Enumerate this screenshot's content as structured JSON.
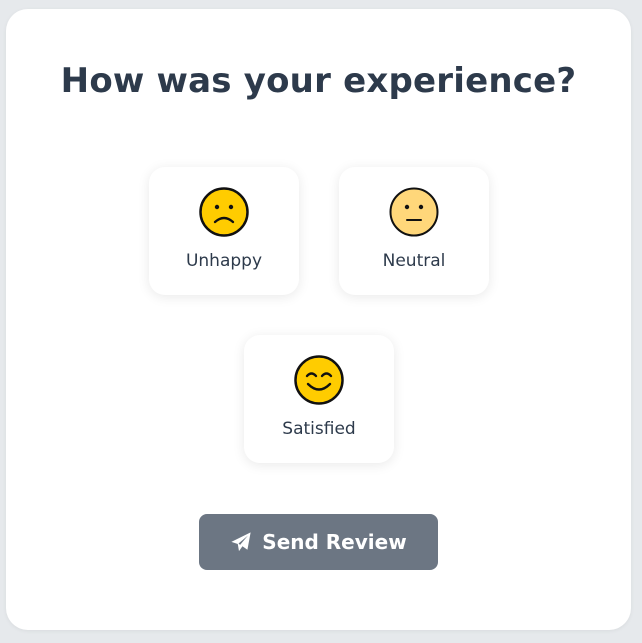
{
  "title": "How was your experience?",
  "options": [
    {
      "label": "Unhappy",
      "icon": "sad-face-icon"
    },
    {
      "label": "Neutral",
      "icon": "neutral-face-icon"
    },
    {
      "label": "Satisfied",
      "icon": "smiling-face-icon"
    }
  ],
  "submit": {
    "label": "Send Review",
    "icon": "paper-plane-icon"
  },
  "colors": {
    "page_background": "#e6e9ec",
    "card_background": "#ffffff",
    "text": "#2d3a4b",
    "button_background": "#6c7683",
    "button_text": "#ffffff",
    "emoji_yellow": "#ffcc00",
    "emoji_pale_yellow": "#ffd77a"
  }
}
